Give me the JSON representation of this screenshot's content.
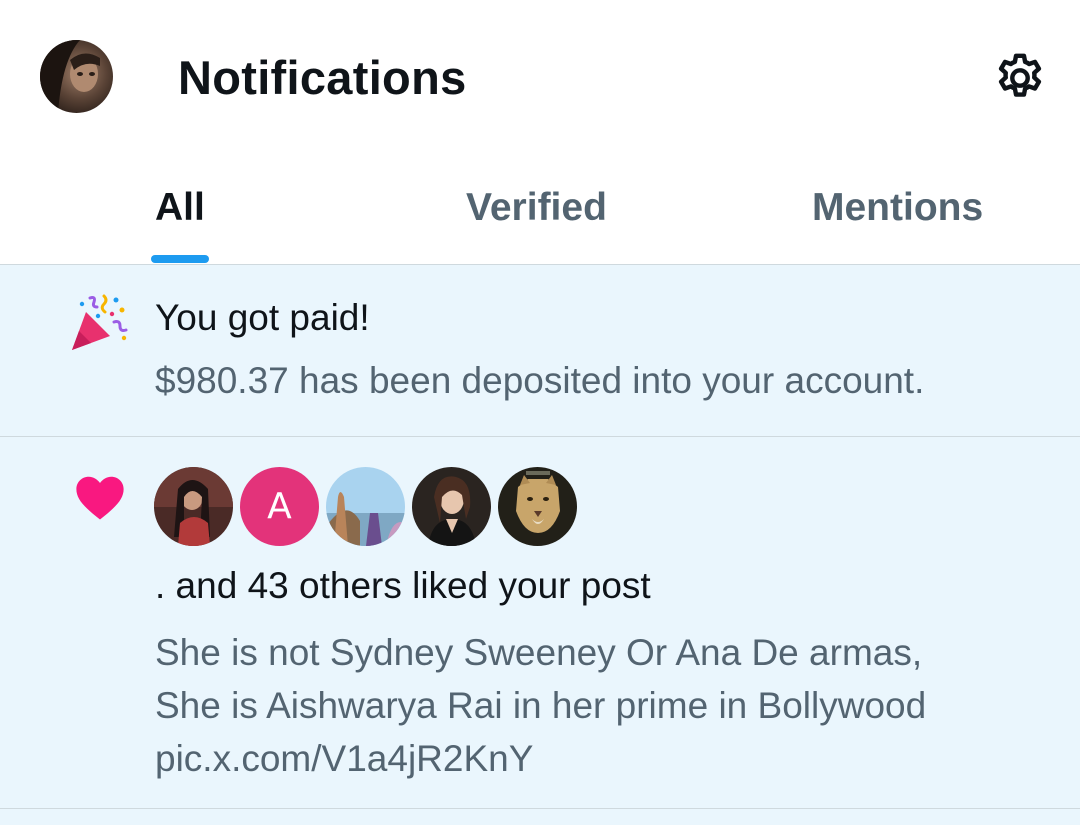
{
  "header": {
    "title": "Notifications",
    "avatar_icon": "user-avatar",
    "settings_icon": "gear-icon"
  },
  "tabs": [
    {
      "label": "All",
      "active": true
    },
    {
      "label": "Verified",
      "active": false
    },
    {
      "label": "Mentions",
      "active": false
    }
  ],
  "notifications": [
    {
      "type": "payment",
      "icon": "party-popper-icon",
      "title": "You got paid!",
      "body": "$980.37 has been deposited into your account."
    },
    {
      "type": "like",
      "icon": "heart-icon",
      "likers": [
        {
          "icon": "avatar-photo-woman"
        },
        {
          "letter": "A",
          "color": "#e3337a"
        },
        {
          "icon": "avatar-landscape"
        },
        {
          "icon": "avatar-photo-woman-2"
        },
        {
          "icon": "avatar-cougar"
        }
      ],
      "title": ". and 43 others liked your post",
      "post_lines": [
        "She is not Sydney Sweeney Or Ana De armas,",
        "She is Aishwarya Rai in her prime in Bollywood",
        "pic.x.com/V1a4jR2KnY"
      ]
    }
  ],
  "colors": {
    "accent": "#1d9bf0",
    "heart": "#f91880",
    "unread_bg": "#eaf6fd",
    "secondary_text": "#536471"
  }
}
